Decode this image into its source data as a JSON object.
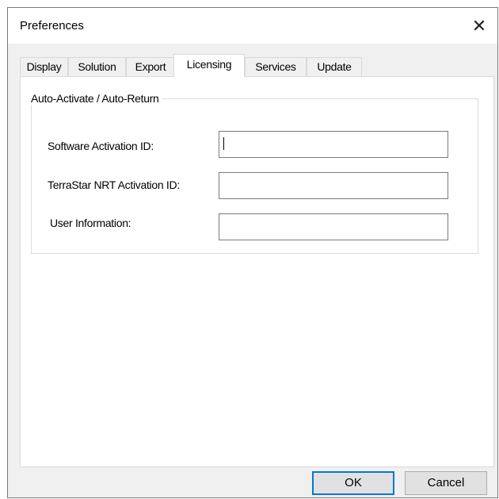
{
  "window": {
    "title": "Preferences"
  },
  "tabs": [
    {
      "label": "Display"
    },
    {
      "label": "Solution"
    },
    {
      "label": "Export"
    },
    {
      "label": "Licensing",
      "active": true
    },
    {
      "label": "Services"
    },
    {
      "label": "Update"
    }
  ],
  "group": {
    "title": "Auto-Activate / Auto-Return",
    "fields": [
      {
        "label": "Software Activation ID:",
        "value": ""
      },
      {
        "label": "TerraStar NRT Activation ID:",
        "value": ""
      },
      {
        "label": "User Information:",
        "value": ""
      }
    ]
  },
  "buttons": {
    "ok": "OK",
    "cancel": "Cancel"
  },
  "icons": {
    "close": "close-icon"
  }
}
